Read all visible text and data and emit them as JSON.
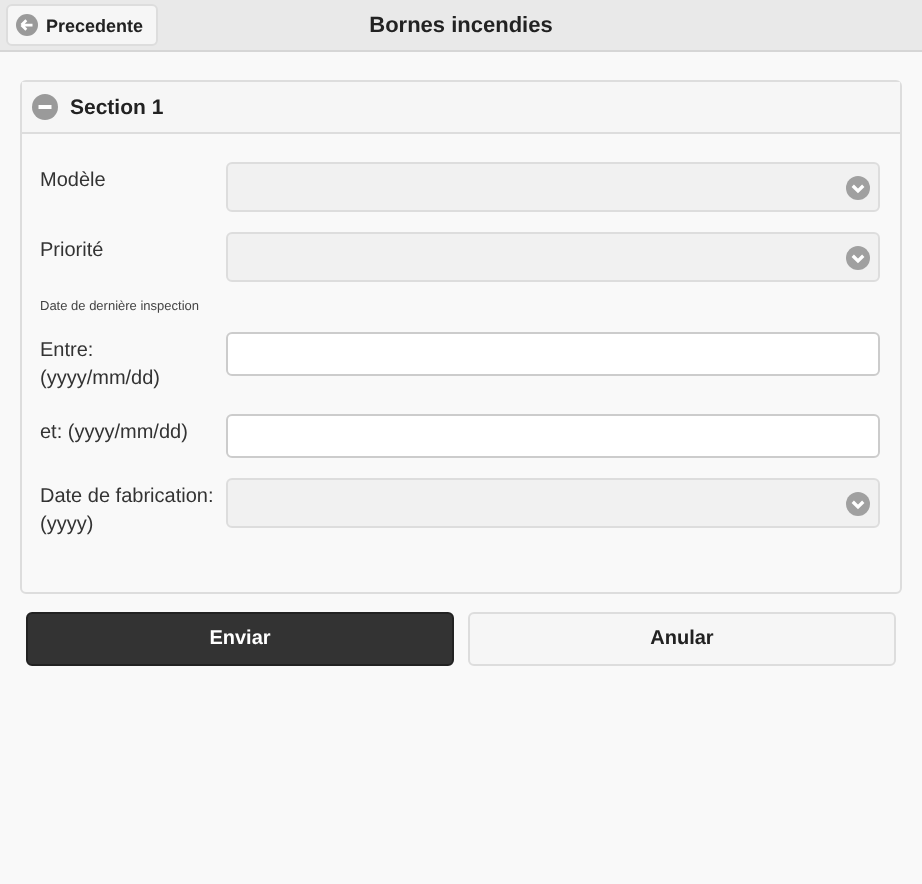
{
  "header": {
    "back_button": "Precedente",
    "title": "Bornes incendies"
  },
  "section": {
    "title": "Section 1",
    "expanded": true,
    "rows": [
      {
        "kind": "select",
        "label": "Modèle"
      },
      {
        "kind": "select",
        "label": "Priorité"
      },
      {
        "kind": "note",
        "label": "Date de dernière inspection"
      },
      {
        "kind": "input",
        "label": "Entre:\n(yyyy/mm/dd)"
      },
      {
        "kind": "input",
        "label": "et: (yyyy/mm/dd)"
      },
      {
        "kind": "select",
        "label": "Date de fabrication:\n(yyyy)"
      }
    ]
  },
  "buttons": [
    {
      "label": "Enviar",
      "kind": "primary"
    },
    {
      "label": "Anular",
      "kind": "secondary"
    }
  ]
}
